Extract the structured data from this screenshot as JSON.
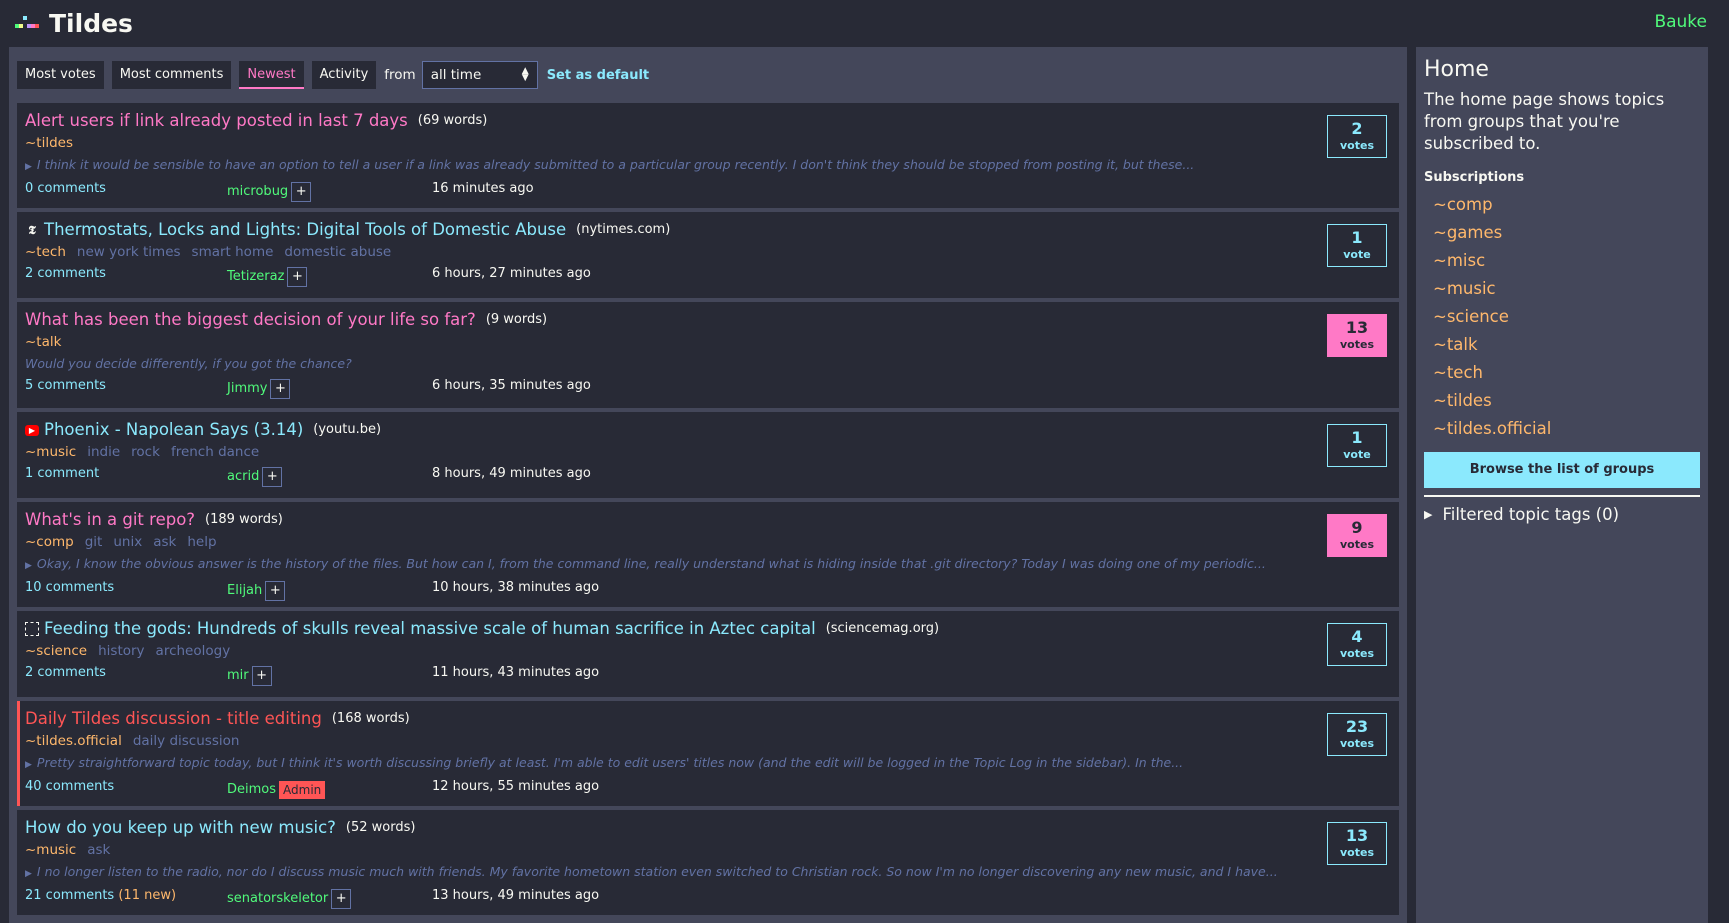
{
  "header": {
    "site_title": "Tildes",
    "username": "Bauke",
    "logo_colors": [
      "#50fa7b",
      "#f1fa8c",
      "#8be9fd",
      "#bd93f9",
      "#ff79c6",
      "#ff5555"
    ]
  },
  "filters": {
    "tabs": [
      "Most votes",
      "Most comments",
      "Newest",
      "Activity"
    ],
    "active": "Newest",
    "from_label": "from",
    "period": "all time",
    "set_default": "Set as default"
  },
  "topics": [
    {
      "title": "Alert users if link already posted in last 7 days",
      "type": "text",
      "meta": "(69 words)",
      "group": "~tildes",
      "tags": [],
      "excerpt": "I think it would be sensible to have an option to tell a user if a link was already submitted to a particular group recently. I don't think they should be stopped from posting it, but these...",
      "excerpt_collapsible": true,
      "comments": "0 comments",
      "new": "",
      "user": "microbug",
      "badge": "",
      "time": "16 minutes ago",
      "votes": "2",
      "vote_label": "votes",
      "hot": false
    },
    {
      "title": "Thermostats, Locks and Lights: Digital Tools of Domestic Abuse",
      "type": "link",
      "icon": "nytimes-icon",
      "meta": "(nytimes.com)",
      "group": "~tech",
      "tags": [
        "new york times",
        "smart home",
        "domestic abuse"
      ],
      "excerpt": "",
      "comments": "2 comments",
      "new": "",
      "user": "Tetizeraz",
      "badge": "",
      "time": "6 hours, 27 minutes ago",
      "votes": "1",
      "vote_label": "vote",
      "hot": false
    },
    {
      "title": "What has been the biggest decision of your life so far?",
      "type": "text",
      "meta": "(9 words)",
      "group": "~talk",
      "tags": [],
      "excerpt": "Would you decide differently, if you got the chance?",
      "excerpt_collapsible": false,
      "comments": "5 comments",
      "new": "",
      "user": "Jimmy",
      "badge": "",
      "time": "6 hours, 35 minutes ago",
      "votes": "13",
      "vote_label": "votes",
      "hot": true
    },
    {
      "title": "Phoenix - Napolean Says (3.14)",
      "type": "link",
      "icon": "youtube-icon",
      "meta": "(youtu.be)",
      "group": "~music",
      "tags": [
        "indie",
        "rock",
        "french dance"
      ],
      "excerpt": "",
      "comments": "1 comment",
      "new": "",
      "user": "acrid",
      "badge": "",
      "time": "8 hours, 49 minutes ago",
      "votes": "1",
      "vote_label": "vote",
      "hot": false
    },
    {
      "title": "What's in a git repo?",
      "type": "text",
      "meta": "(189 words)",
      "group": "~comp",
      "tags": [
        "git",
        "unix",
        "ask",
        "help"
      ],
      "excerpt": "Okay, I know the obvious answer is the history of the files. But how can I, from the command line, really understand what is hiding inside that .git directory? Today I was doing one of my periodic...",
      "excerpt_collapsible": true,
      "comments": "10 comments",
      "new": "",
      "user": "Elijah",
      "badge": "",
      "time": "10 hours, 38 minutes ago",
      "votes": "9",
      "vote_label": "votes",
      "hot": true
    },
    {
      "title": "Feeding the gods: Hundreds of skulls reveal massive scale of human sacrifice in Aztec capital",
      "type": "link",
      "icon": "placeholder-link-icon",
      "meta": "(sciencemag.org)",
      "group": "~science",
      "tags": [
        "history",
        "archeology"
      ],
      "excerpt": "",
      "comments": "2 comments",
      "new": "",
      "user": "mir",
      "badge": "",
      "time": "11 hours, 43 minutes ago",
      "votes": "4",
      "vote_label": "votes",
      "hot": false
    },
    {
      "title": "Daily Tildes discussion - title editing",
      "type": "official",
      "meta": "(168 words)",
      "group": "~tildes.official",
      "tags": [
        "daily discussion"
      ],
      "excerpt": "Pretty straightforward topic today, but I think it's worth discussing briefly at least. I'm able to edit users' titles now (and the edit will be logged in the Topic Log in the sidebar). In the...",
      "excerpt_collapsible": true,
      "comments": "40 comments",
      "new": "",
      "user": "Deimos",
      "badge": "Admin",
      "time": "12 hours, 55 minutes ago",
      "votes": "23",
      "vote_label": "votes",
      "hot": false
    },
    {
      "title": "How do you keep up with new music?",
      "type": "question",
      "meta": "(52 words)",
      "group": "~music",
      "tags": [
        "ask"
      ],
      "excerpt": "I no longer listen to the radio, nor do I discuss music much with friends. My favorite hometown station even switched to Christian rock. So now I'm no longer discovering any new music, and I have...",
      "excerpt_collapsible": true,
      "comments": "21 comments",
      "new": "(11 new)",
      "user": "senatorskeletor",
      "badge": "",
      "time": "13 hours, 49 minutes ago",
      "votes": "13",
      "vote_label": "votes",
      "hot": false
    }
  ],
  "sidebar": {
    "title": "Home",
    "description": "The home page shows topics from groups that you're subscribed to.",
    "subscriptions_label": "Subscriptions",
    "subscriptions": [
      "~comp",
      "~games",
      "~misc",
      "~music",
      "~science",
      "~talk",
      "~tech",
      "~tildes",
      "~tildes.official"
    ],
    "browse_button": "Browse the list of groups",
    "filtered_tags": "Filtered topic tags (0)"
  }
}
